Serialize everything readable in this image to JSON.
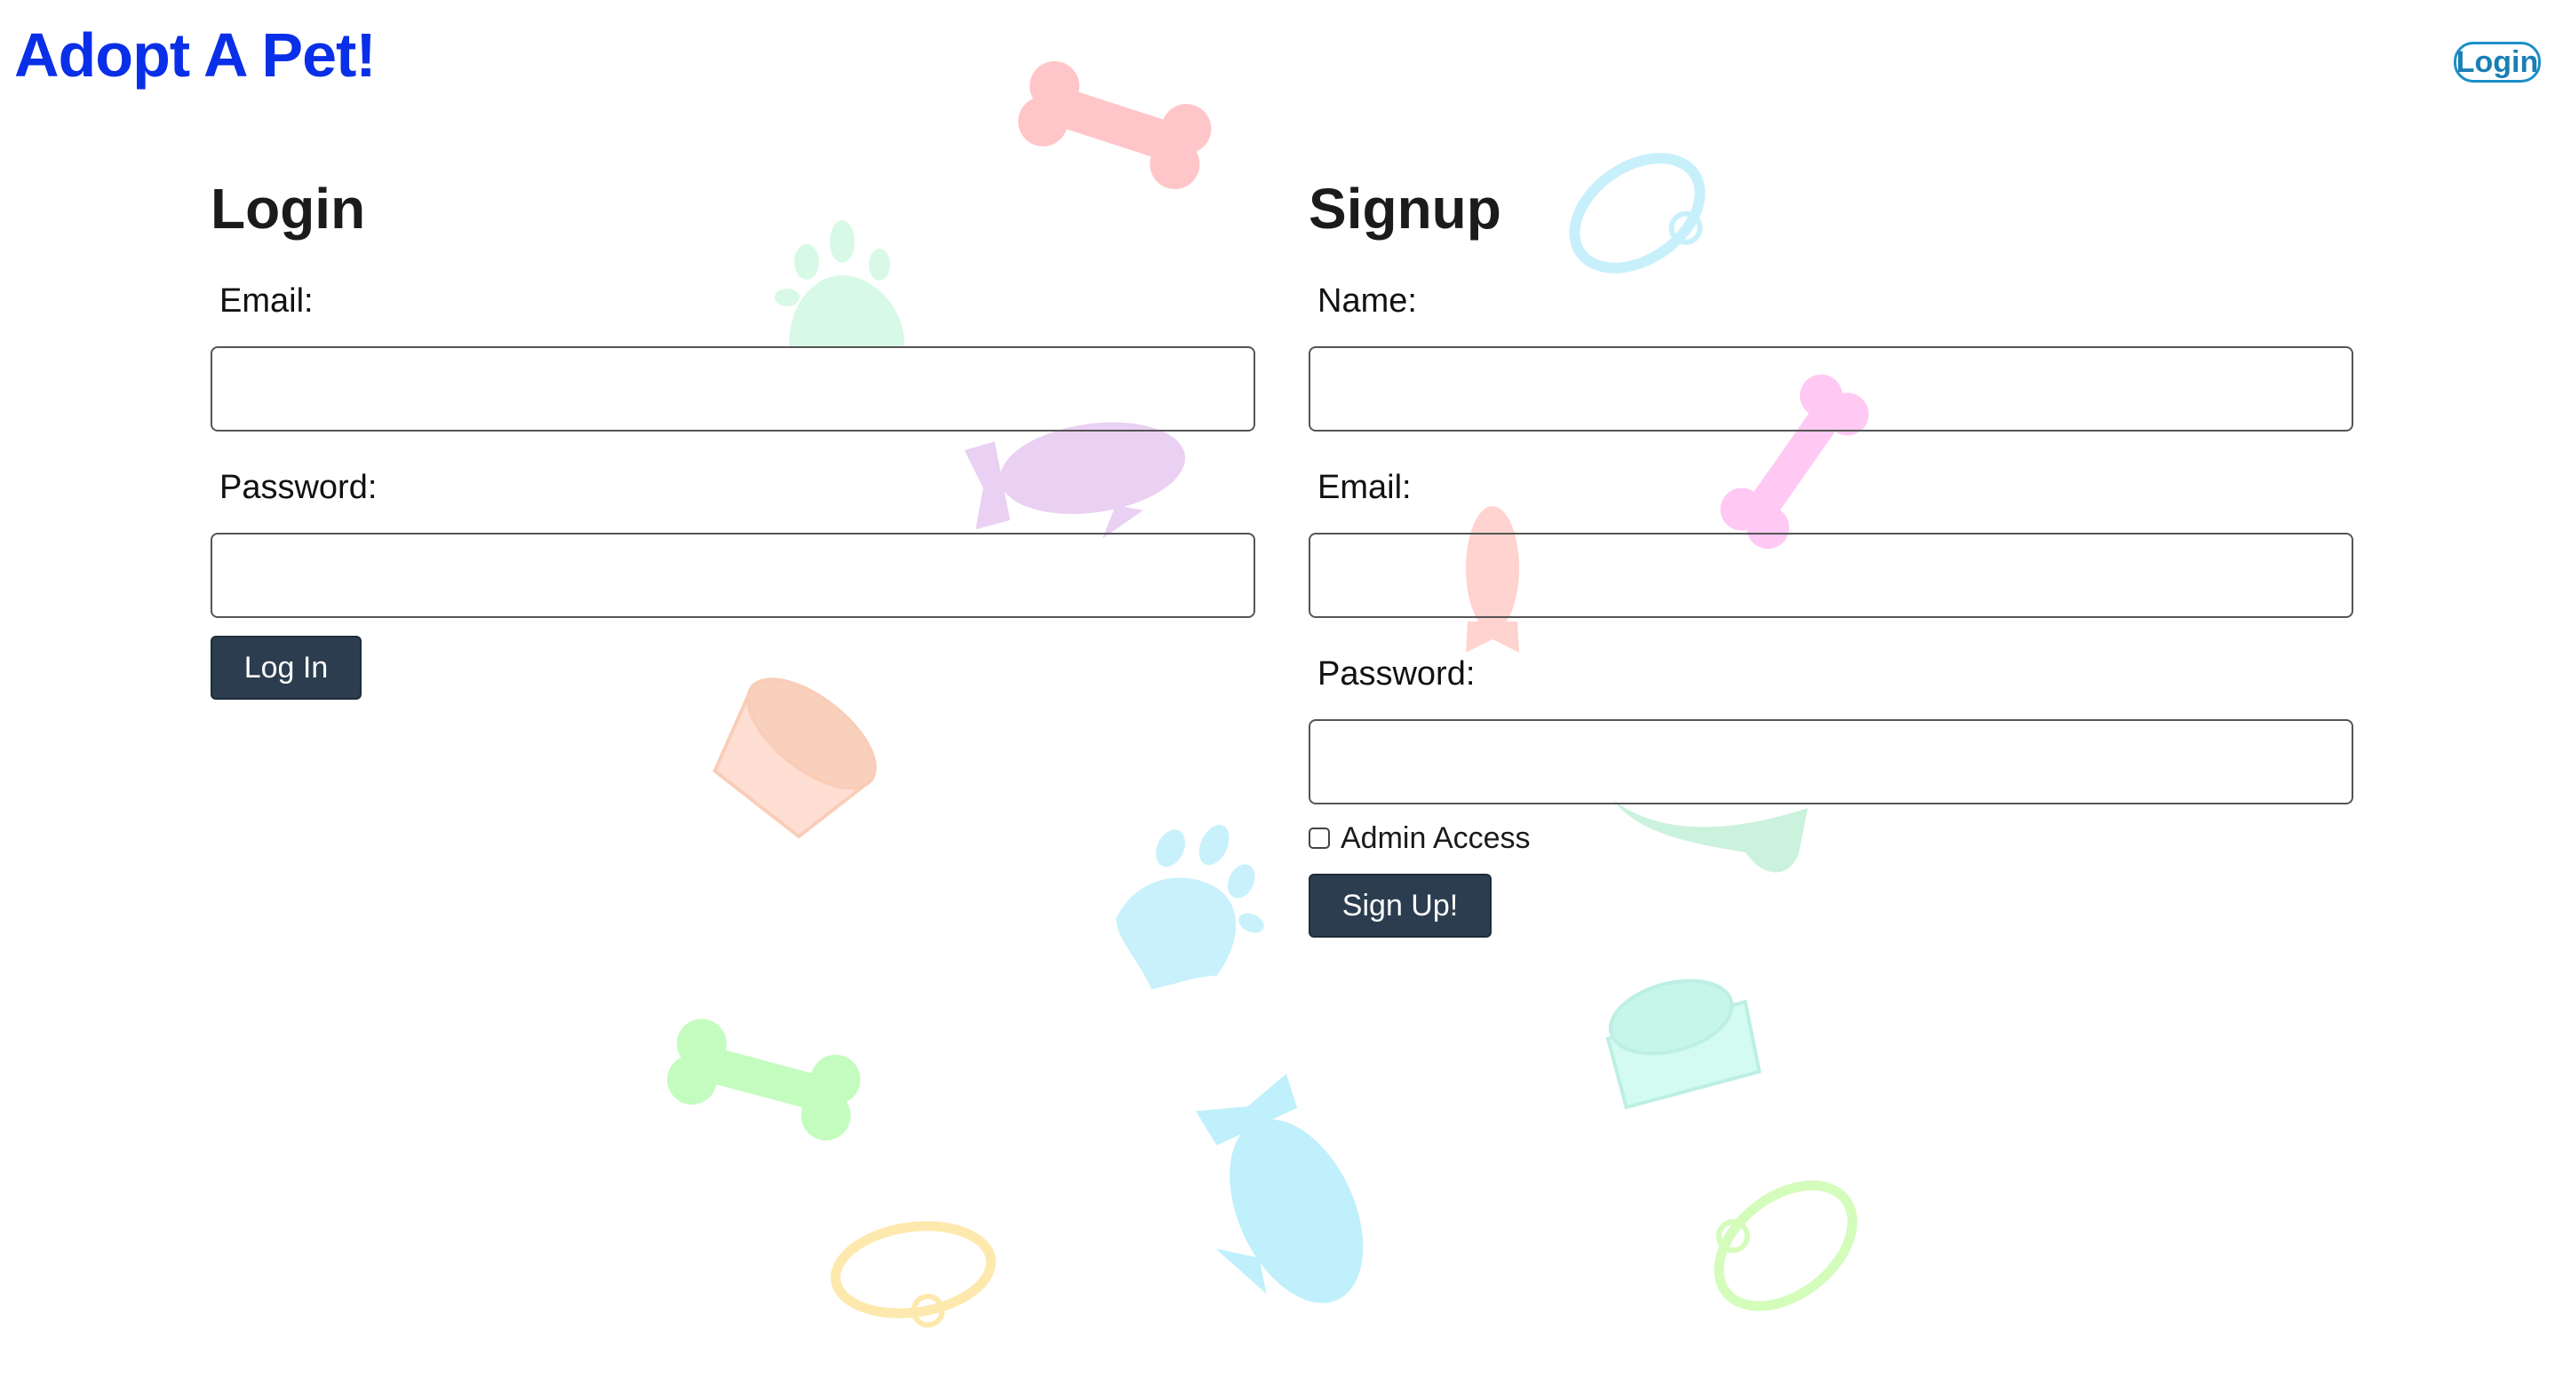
{
  "header": {
    "brand": "Adopt A Pet!",
    "login_link": "Login"
  },
  "login": {
    "title": "Login",
    "email_label": "Email:",
    "email_value": "",
    "password_label": "Password:",
    "password_value": "",
    "submit_label": "Log In"
  },
  "signup": {
    "title": "Signup",
    "name_label": "Name:",
    "name_value": "",
    "email_label": "Email:",
    "email_value": "",
    "password_label": "Password:",
    "password_value": "",
    "admin_label": "Admin Access",
    "admin_checked": false,
    "submit_label": "Sign Up!"
  },
  "colors": {
    "brand": "#0a2fe8",
    "button": "#2b3d4f",
    "nav_login": "#1a8fc7"
  },
  "background_icons": [
    "bone-icon",
    "paw-icon",
    "collar-icon",
    "fish-icon",
    "bowl-icon"
  ]
}
